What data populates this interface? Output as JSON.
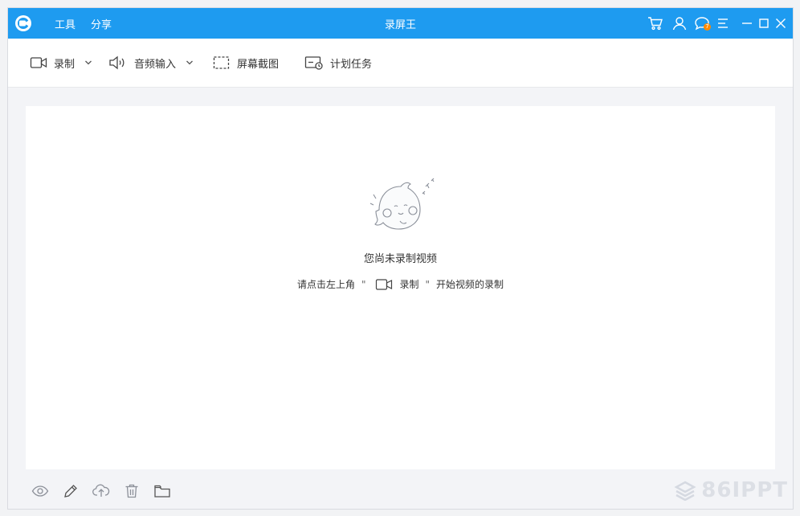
{
  "titlebar": {
    "title": "录屏王",
    "menu": [
      {
        "label": "工具"
      },
      {
        "label": "分享"
      }
    ],
    "message_badge": "7",
    "accent": "#1e9bf0"
  },
  "toolbar": {
    "record_label": "录制",
    "audio_label": "音频输入",
    "screenshot_label": "屏幕截图",
    "schedule_label": "计划任务"
  },
  "empty_state": {
    "title": "您尚未录制视频",
    "hint_before": "请点击左上角",
    "quote_open": "\"",
    "record_label": "录制",
    "quote_close": "\"",
    "hint_after": "开始视频的录制"
  },
  "bottombar": {
    "icons": [
      "eye-icon",
      "pencil-icon",
      "cloud-upload-icon",
      "trash-icon",
      "folder-icon"
    ]
  },
  "watermark": {
    "text": "86IPPT"
  }
}
